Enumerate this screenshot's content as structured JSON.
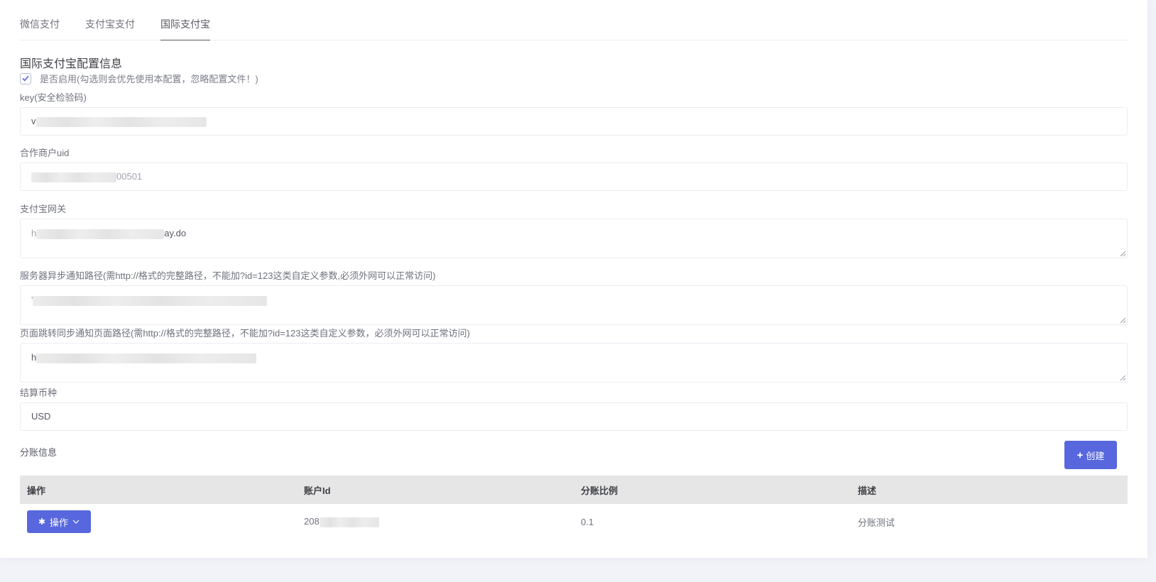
{
  "tabs": [
    {
      "label": "微信支付",
      "active": false
    },
    {
      "label": "支付宝支付",
      "active": false
    },
    {
      "label": "国际支付宝",
      "active": true
    }
  ],
  "section_title": "国际支付宝配置信息",
  "enable": {
    "checked": true,
    "label": "是否启用(勾选则会优先使用本配置，忽略配置文件！)"
  },
  "fields": {
    "key": {
      "label": "key(安全检验码)",
      "value_prefix": "v"
    },
    "partner_uid": {
      "label": "合作商户uid",
      "value_suffix": "00501"
    },
    "gateway": {
      "label": "支付宝网关",
      "value_prefix": "h",
      "value_suffix": "ay.do"
    },
    "notify_url": {
      "label": "服务器异步通知路径(需http://格式的完整路径，不能加?id=123这类自定义参数,必须外网可以正常访问)",
      "value_prefix": "'"
    },
    "return_url": {
      "label": "页面跳转同步通知页面路径(需http://格式的完整路径，不能加?id=123这类自定义参数，必须外网可以正常访问)",
      "value_prefix": "h"
    },
    "currency": {
      "label": "结算币种",
      "value": "USD"
    }
  },
  "split": {
    "title": "分账信息",
    "create_label": "创建",
    "columns": [
      "操作",
      "账户Id",
      "分账比例",
      "描述"
    ],
    "rows": [
      {
        "action_label": "操作",
        "account_id_prefix": "208",
        "ratio": "0.1",
        "description": "分账测试"
      }
    ]
  },
  "colors": {
    "accent": "#5867dd",
    "header_bg": "#e6e6e6",
    "page_bg": "#f2f3f8"
  }
}
